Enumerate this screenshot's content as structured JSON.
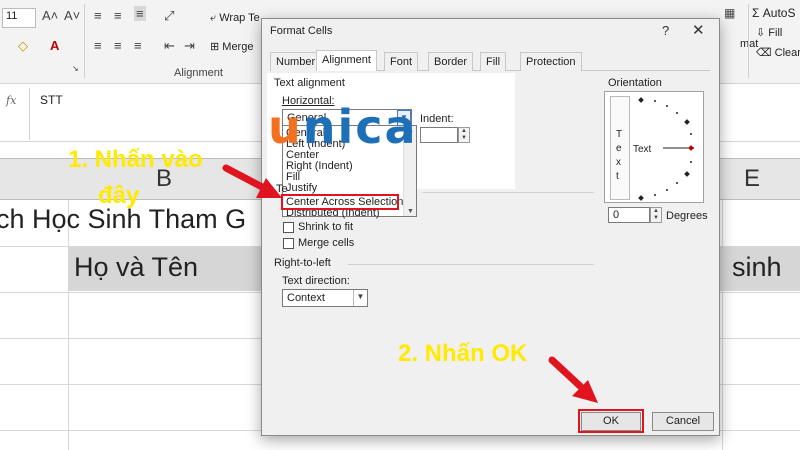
{
  "excel": {
    "font_size": "11",
    "ribbon": {
      "wrap_text": "Wrap Te",
      "merge": "Merge",
      "alignment_group": "Alignment",
      "autosum": "AutoS",
      "fill": "Fill",
      "clear": "Clear",
      "format_fragment": "mat"
    },
    "formula_bar": {
      "fx": "fx",
      "value": "STT"
    },
    "column_headers": {
      "b": "B",
      "e": "E"
    },
    "cells": {
      "title_fragment": "ch Học Sinh Tham G",
      "name_header": "Họ và Tên",
      "sinh_fragment": "sinh"
    }
  },
  "dialog": {
    "title": "Format Cells",
    "help": "?",
    "close": "✕",
    "tabs": [
      {
        "label": "Number"
      },
      {
        "label": "Alignment"
      },
      {
        "label": "Font"
      },
      {
        "label": "Border"
      },
      {
        "label": "Fill"
      },
      {
        "label": "Protection"
      }
    ],
    "text_alignment": {
      "heading": "Text alignment",
      "horizontal_label": "Horizontal:",
      "horizontal_value": "General",
      "indent_label": "Indent:",
      "options": [
        "General",
        "Left (Indent)",
        "Center",
        "Right (Indent)",
        "Fill",
        "Justify",
        "Center Across Selection",
        "Distributed (Indent)"
      ],
      "vertical_fragment": "Te"
    },
    "text_control": {
      "shrink_to_fit": "Shrink to fit",
      "merge_cells": "Merge cells"
    },
    "right_to_left": {
      "heading": "Right-to-left",
      "direction_label": "Text direction:",
      "direction_value": "Context"
    },
    "orientation": {
      "heading": "Orientation",
      "vertical_text": [
        "T",
        "e",
        "x",
        "t"
      ],
      "horizontal_text": "Text",
      "degrees_value": "0",
      "degrees_label": "Degrees"
    },
    "ok_label": "OK",
    "cancel_label": "Cancel"
  },
  "annotations": {
    "step1_line1": "1. Nhấn vào",
    "step1_line2": "đây",
    "step2": "2. Nhấn OK"
  },
  "watermark": "unica",
  "colors": {
    "annotation_yellow": "#ffea00",
    "highlight_red": "#e0141e",
    "unica_orange": "#f37021",
    "unica_blue": "#1d6fb8"
  }
}
